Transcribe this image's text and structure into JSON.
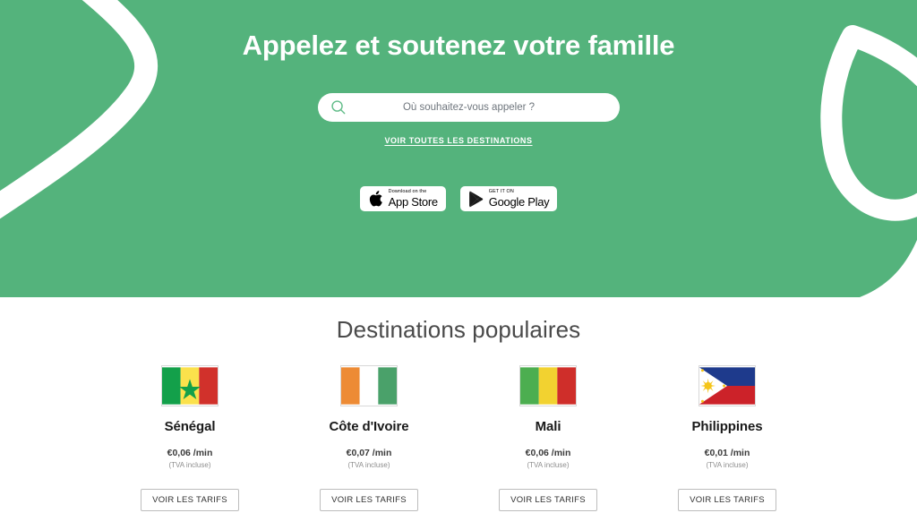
{
  "theme": {
    "brand_green": "#54b37c",
    "hero_text": "#ffffff",
    "heading_gray": "#4a4a4a"
  },
  "hero": {
    "title": "Appelez et soutenez votre famille",
    "search": {
      "icon": "search-icon",
      "placeholder": "Où souhaitez-vous appeler ?",
      "value": ""
    },
    "all_destinations_link": "VOIR TOUTES LES DESTINATIONS",
    "stores": [
      {
        "icon": "apple-icon",
        "top_label": "Download on the",
        "main_label": "App Store"
      },
      {
        "icon": "google-play-icon",
        "top_label": "GET IT ON",
        "main_label": "Google Play"
      }
    ],
    "decorations": [
      "swoosh-curve-left",
      "leaf-outline-right"
    ]
  },
  "destinations": {
    "title": "Destinations populaires",
    "cards": [
      {
        "flag": "flag-senegal",
        "country": "Sénégal",
        "price": "€0,06 /min",
        "vat_note": "(TVA incluse)",
        "button_label": "VOIR LES TARIFS"
      },
      {
        "flag": "flag-cote-divoire",
        "country": "Côte d'Ivoire",
        "price": "€0,07 /min",
        "vat_note": "(TVA incluse)",
        "button_label": "VOIR LES TARIFS"
      },
      {
        "flag": "flag-mali",
        "country": "Mali",
        "price": "€0,06 /min",
        "vat_note": "(TVA incluse)",
        "button_label": "VOIR LES TARIFS"
      },
      {
        "flag": "flag-philippines",
        "country": "Philippines",
        "price": "€0,01 /min",
        "vat_note": "(TVA incluse)",
        "button_label": "VOIR LES TARIFS"
      }
    ]
  }
}
